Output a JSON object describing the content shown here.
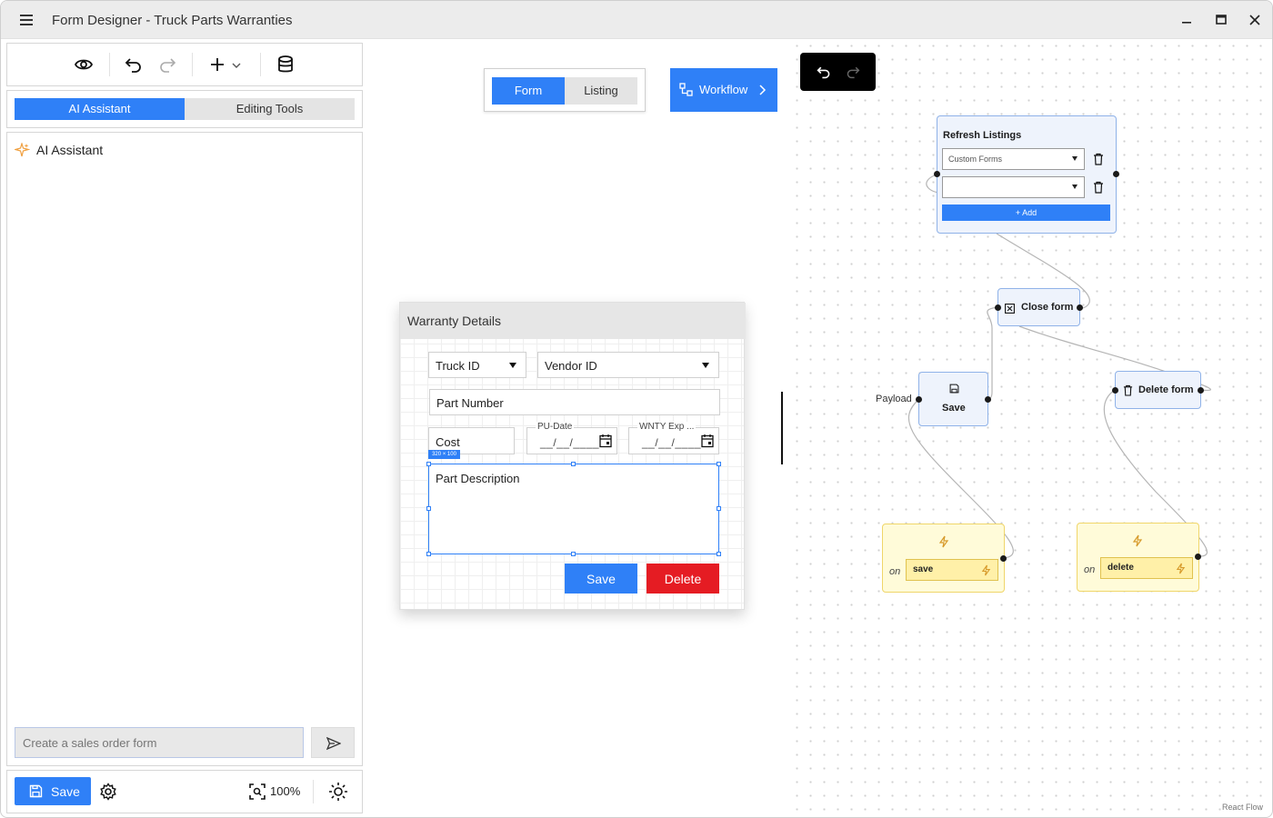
{
  "window": {
    "title": "Form Designer - Truck Parts Warranties"
  },
  "left_panel": {
    "tabs": [
      {
        "label": "AI Assistant",
        "active": true
      },
      {
        "label": "Editing Tools",
        "active": false
      }
    ],
    "assistant_title": "AI Assistant",
    "chat_placeholder": "Create a sales order form",
    "save_label": "Save",
    "zoom": "100%"
  },
  "canvas": {
    "mode_tabs": [
      {
        "label": "Form",
        "active": true
      },
      {
        "label": "Listing",
        "active": false
      }
    ],
    "workflow_label": "Workflow",
    "attribution": "React Flow"
  },
  "form": {
    "header": "Warranty Details",
    "truck_id": "Truck ID",
    "vendor_id": "Vendor ID",
    "part_number": "Part Number",
    "cost": "Cost",
    "pu_date_label": "PU-Date",
    "pu_date_placeholder": "__/__/____",
    "wnty_exp_label": "WNTY Exp ...",
    "wnty_exp_placeholder": "__/__/____",
    "size_badge": "320 × 100",
    "part_description": "Part Description",
    "save_label": "Save",
    "delete_label": "Delete"
  },
  "workflow": {
    "refresh_node": {
      "title": "Refresh Listings",
      "select1": "Custom Forms",
      "select2": "",
      "add_label": "+ Add"
    },
    "close_node": {
      "title": "Close form"
    },
    "save_node": {
      "title": "Save",
      "input_label": "Payload"
    },
    "delete_node": {
      "title": "Delete form"
    },
    "event_save": {
      "on_label": "on",
      "event": "save"
    },
    "event_delete": {
      "on_label": "on",
      "event": "delete"
    }
  },
  "colors": {
    "accent": "#2f80f7",
    "danger": "#e51c23",
    "event_bg": "#fffbd9",
    "node_bg": "#eef3fc"
  },
  "icons": [
    "hamburger-icon",
    "minimize-icon",
    "maximize-icon",
    "close-icon",
    "eye-icon",
    "undo-icon",
    "redo-icon",
    "plus-icon",
    "chevron-down-icon",
    "database-icon",
    "sparkle-icon",
    "send-icon",
    "save-icon",
    "gear-icon",
    "zoom-fit-icon",
    "sun-icon",
    "workflow-icon",
    "chevron-right-icon",
    "calendar-icon",
    "trash-icon",
    "close-box-icon",
    "lightning-icon"
  ]
}
